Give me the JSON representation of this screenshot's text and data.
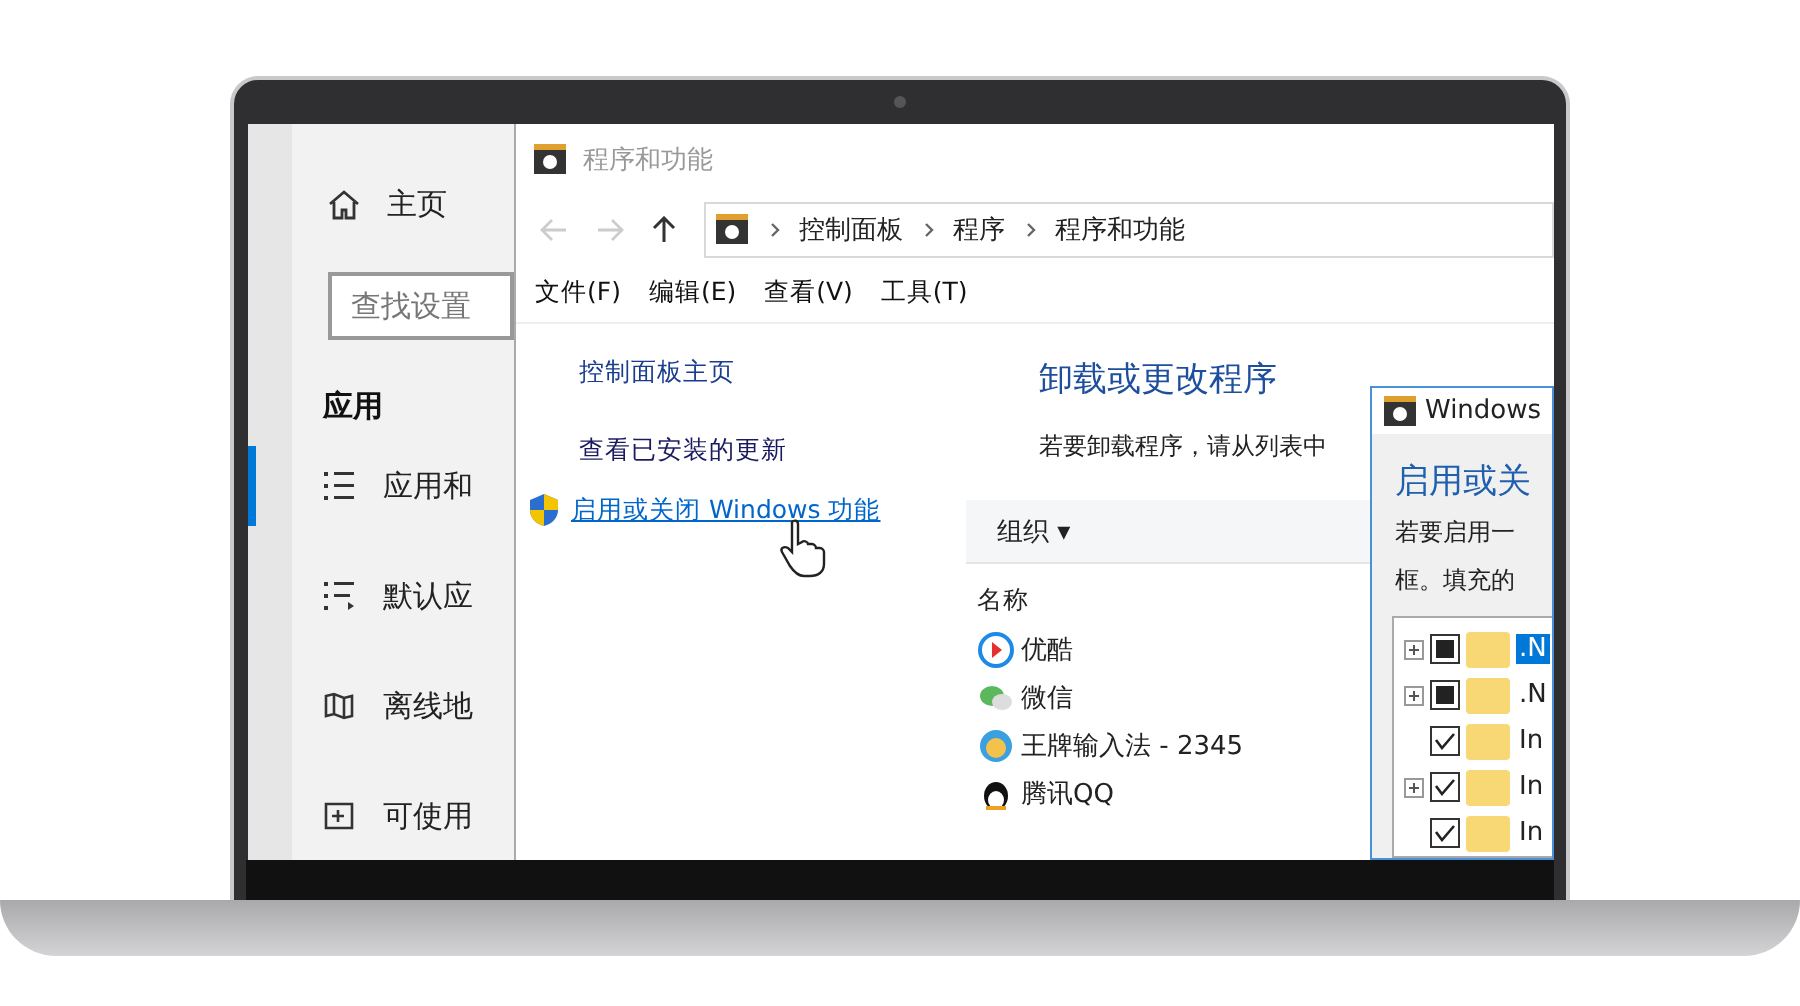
{
  "settings": {
    "home": "主页",
    "search": {
      "placeholder": "查找设置"
    },
    "section": "应用",
    "items": [
      {
        "label": "应用和",
        "kind": "list",
        "selected": true
      },
      {
        "label": "默认应",
        "kind": "defaults",
        "selected": false
      },
      {
        "label": "离线地",
        "kind": "map",
        "selected": false
      },
      {
        "label": "可使用",
        "kind": "open",
        "selected": false
      }
    ]
  },
  "window": {
    "title": "程序和功能",
    "breadcrumb": [
      "控制面板",
      "程序",
      "程序和功能"
    ],
    "menu": [
      "文件(F)",
      "编辑(E)",
      "查看(V)",
      "工具(T)"
    ],
    "left_links": [
      {
        "label": "控制面板主页",
        "kind": "plain"
      },
      {
        "label": "查看已安装的更新",
        "kind": "plain"
      },
      {
        "label": "启用或关闭 Windows 功能",
        "kind": "shield"
      }
    ],
    "heading": "卸载或更改程序",
    "description": "若要卸载程序，请从列表中",
    "toolbar": {
      "organize": "组织 ▾"
    },
    "column": "名称",
    "programs": [
      {
        "name": "优酷",
        "kind": "play"
      },
      {
        "name": "微信",
        "kind": "chat"
      },
      {
        "name": "王牌输入法 - 2345",
        "kind": "ime"
      },
      {
        "name": "腾讯QQ",
        "kind": "penguin"
      }
    ]
  },
  "features_dialog": {
    "title": "Windows",
    "heading": "启用或关",
    "text_lines": [
      "若要启用一",
      "框。填充的"
    ],
    "items": [
      {
        "label": ".N",
        "expandable": true,
        "checked": false,
        "indeterminate": true,
        "selected": true
      },
      {
        "label": ".N",
        "expandable": true,
        "checked": false,
        "indeterminate": true,
        "selected": false
      },
      {
        "label": "In",
        "expandable": false,
        "checked": true,
        "indeterminate": false,
        "selected": false
      },
      {
        "label": "In",
        "expandable": true,
        "checked": true,
        "indeterminate": false,
        "selected": false
      },
      {
        "label": "In",
        "expandable": false,
        "checked": true,
        "indeterminate": false,
        "selected": false
      }
    ]
  }
}
